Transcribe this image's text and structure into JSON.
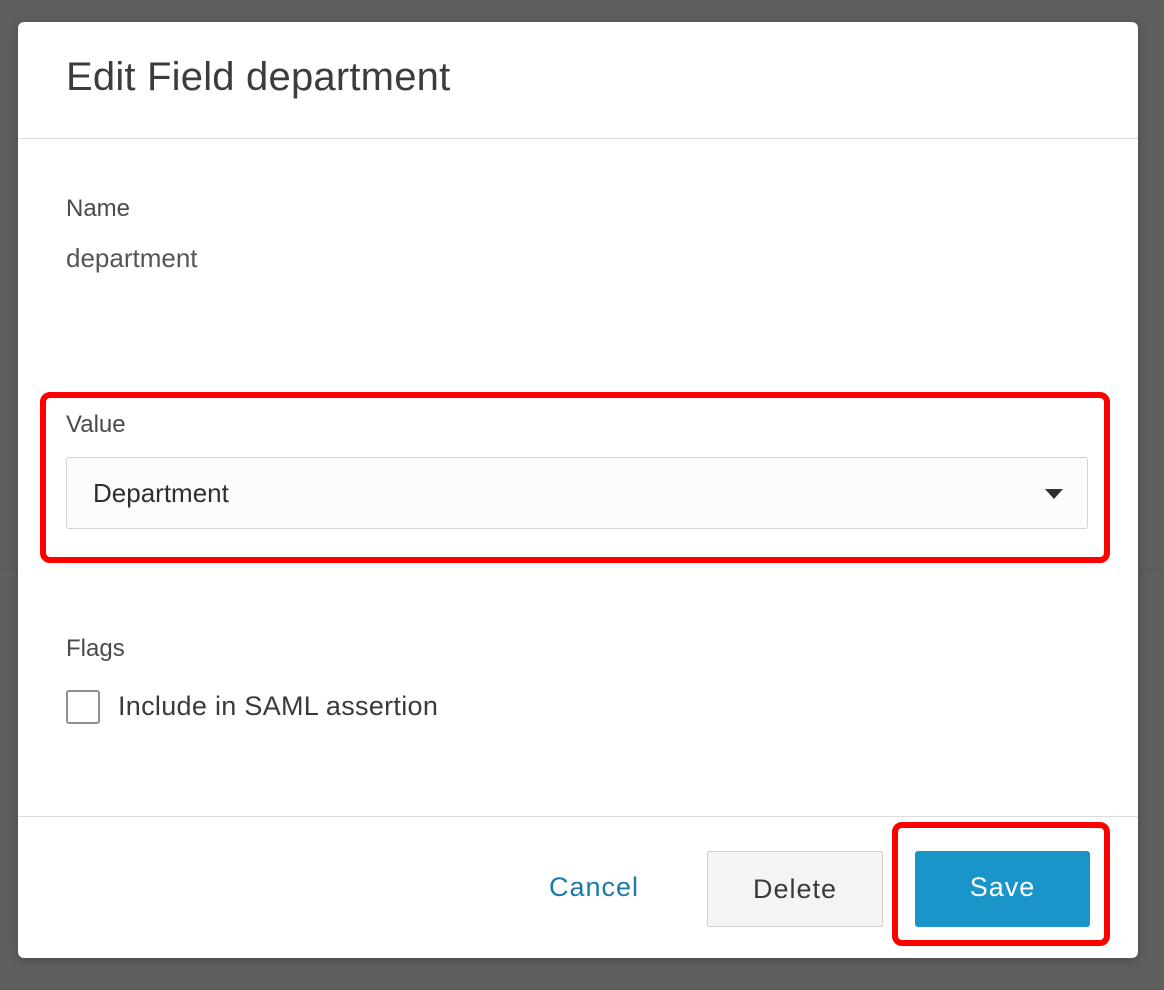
{
  "dialog": {
    "title": "Edit Field department",
    "name_label": "Name",
    "name_value": "department",
    "value_label": "Value",
    "value_selected": "Department",
    "flags_label": "Flags",
    "flags": [
      {
        "label": "Include in SAML assertion",
        "checked": false
      }
    ]
  },
  "footer": {
    "cancel_label": "Cancel",
    "delete_label": "Delete",
    "save_label": "Save"
  },
  "colors": {
    "accent": "#1a95c9",
    "link": "#1a7aa8",
    "highlight": "#ff0000"
  },
  "icons": {
    "dropdown": "caret-down-icon"
  }
}
